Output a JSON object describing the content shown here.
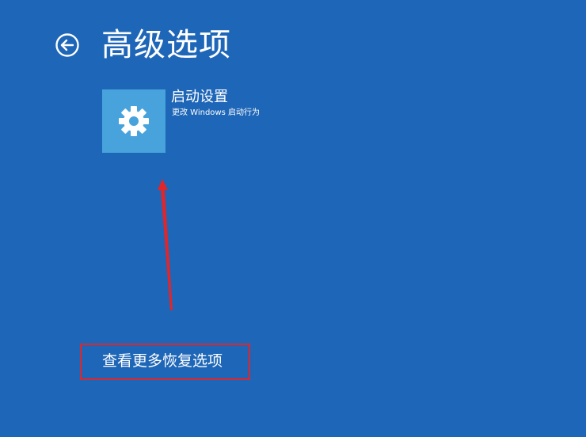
{
  "header": {
    "title": "高级选项",
    "back_icon": "back-arrow-icon"
  },
  "options": [
    {
      "title": "启动设置",
      "description": "更改 Windows 启动行为",
      "icon": "gear-icon",
      "icon_bg_color": "#48a3dc"
    }
  ],
  "footer": {
    "more_options_label": "查看更多恢复选项"
  },
  "annotations": {
    "highlight_color": "#e0262b",
    "arrow_color": "#e0262b"
  },
  "theme": {
    "background": "#1e66b7",
    "text": "#ffffff"
  }
}
